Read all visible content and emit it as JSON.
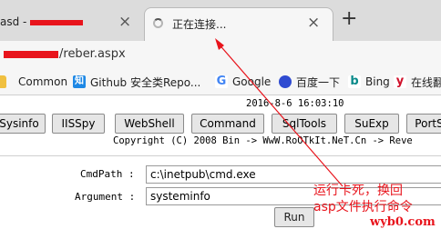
{
  "tabs": [
    {
      "title": "asd -",
      "state": "inactive"
    },
    {
      "title": "正在连接...",
      "state": "active"
    }
  ],
  "tab_close_glyph": "×",
  "new_tab_glyph": "+",
  "address": {
    "url_suffix": "/reber.aspx"
  },
  "bookmarks": [
    {
      "label": "",
      "icon": "folder-icon"
    },
    {
      "label": "Common",
      "icon": "folder-icon"
    },
    {
      "label": "Github 安全类Repo...",
      "icon": "zhihu-icon",
      "glyph": "知"
    },
    {
      "label": "Google",
      "icon": "google-icon",
      "glyph": "G"
    },
    {
      "label": "百度一下",
      "icon": "baidu-icon",
      "glyph": "🐾"
    },
    {
      "label": "Bing",
      "icon": "bing-icon",
      "glyph": "b"
    },
    {
      "label": "在线翻",
      "icon": "y-icon",
      "glyph": "y"
    }
  ],
  "page": {
    "datetime": "2016-8-6 16:03:10",
    "tools": [
      "Sysinfo",
      "IISSpy",
      "WebShell",
      "Command",
      "SqlTools",
      "SuExp",
      "PortS"
    ],
    "copyright": "Copyright (C) 2008 Bin -> WwW.RoOTkIt.NeT.Cn -> Reve",
    "cmdpath_label": "CmdPath :",
    "cmdpath_value": "c:\\inetpub\\cmd.exe",
    "argument_label": "Argument :",
    "argument_value": "systeminfo",
    "run_label": "Run"
  },
  "annotation": {
    "line1": "运行卡死，换回",
    "line2": "asp文件执行命令",
    "color": "#e8141c"
  },
  "watermark": "wyb0.com"
}
